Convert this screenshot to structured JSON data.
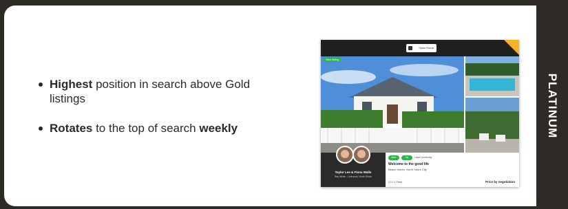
{
  "bullets": [
    {
      "bold": "Highest",
      "rest": " position in search above Gold listings"
    },
    {
      "bold": "Rotates",
      "rest": " to the top of search ",
      "bold2": "weekly"
    }
  ],
  "tier_label": "PLATINUM",
  "listing": {
    "top_button": "Open Home",
    "badge": "New listing",
    "agent_names": "Taylor Lee & Fiona Walls",
    "agency": "Ray White - Liverpool, North Shore",
    "pills": [
      "New",
      "3d"
    ],
    "listed_text": "Listed yesterday",
    "title": "Welcome to the good life",
    "location": "Beach Haven, North Shore City",
    "features": "3  2  1  1  Fixed",
    "price": "Price by negotiation"
  },
  "colors": {
    "tier_dark": "#2e2b27",
    "badge_green": "#2fb34a",
    "corner_gold": "#f3b322"
  }
}
